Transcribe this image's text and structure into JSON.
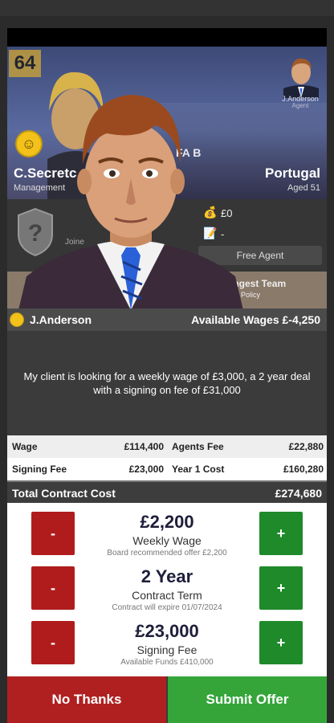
{
  "player": {
    "rating": "64",
    "name": "C.Secretc",
    "role": "Management",
    "club_fragment": "FA B",
    "nation": "Portugal",
    "age": "Aged 51",
    "joined_fragment": "Joine",
    "fee_value": "£0",
    "fee_value2": "-",
    "free_agent": "Free Agent",
    "strongest_team": "ongest Team",
    "selection_policy": "tion Policy"
  },
  "agent_thumb": {
    "name": "J.Anderson",
    "role": "Agent"
  },
  "agent_bar": {
    "name": "J.Anderson",
    "available_wages": "Available Wages £-4,250"
  },
  "message": "My client is looking for a weekly wage of £3,000, a 2 year deal with a signing on fee of £31,000",
  "costs": {
    "rows": [
      [
        {
          "label": "Wage",
          "value": "£114,400"
        },
        {
          "label": "Agents Fee",
          "value": "£22,880"
        }
      ],
      [
        {
          "label": "Signing Fee",
          "value": "£23,000"
        },
        {
          "label": "Year 1 Cost",
          "value": "£160,280"
        }
      ]
    ],
    "total_label": "Total Contract Cost",
    "total_value": "£274,680"
  },
  "negotiation": [
    {
      "value": "£2,200",
      "label": "Weekly Wage",
      "hint": "Board recommended offer £2,200",
      "minus": "-",
      "plus": "+"
    },
    {
      "value": "2 Year",
      "label": "Contract Term",
      "hint": "Contract will expire 01/07/2024",
      "minus": "-",
      "plus": "+"
    },
    {
      "value": "£23,000",
      "label": "Signing Fee",
      "hint": "Available Funds £410,000",
      "minus": "-",
      "plus": "+"
    }
  ],
  "actions": {
    "no_thanks": "No Thanks",
    "submit": "Submit Offer"
  },
  "colors": {
    "decline": "#b02020",
    "accept": "#35a53a",
    "minus": "#b01c1c",
    "plus": "#1e8a2a"
  },
  "icons": {
    "smiley": "smiley-face-icon",
    "shield": "club-shield-icon",
    "money": "money-bag-icon",
    "contract": "contract-icon"
  }
}
